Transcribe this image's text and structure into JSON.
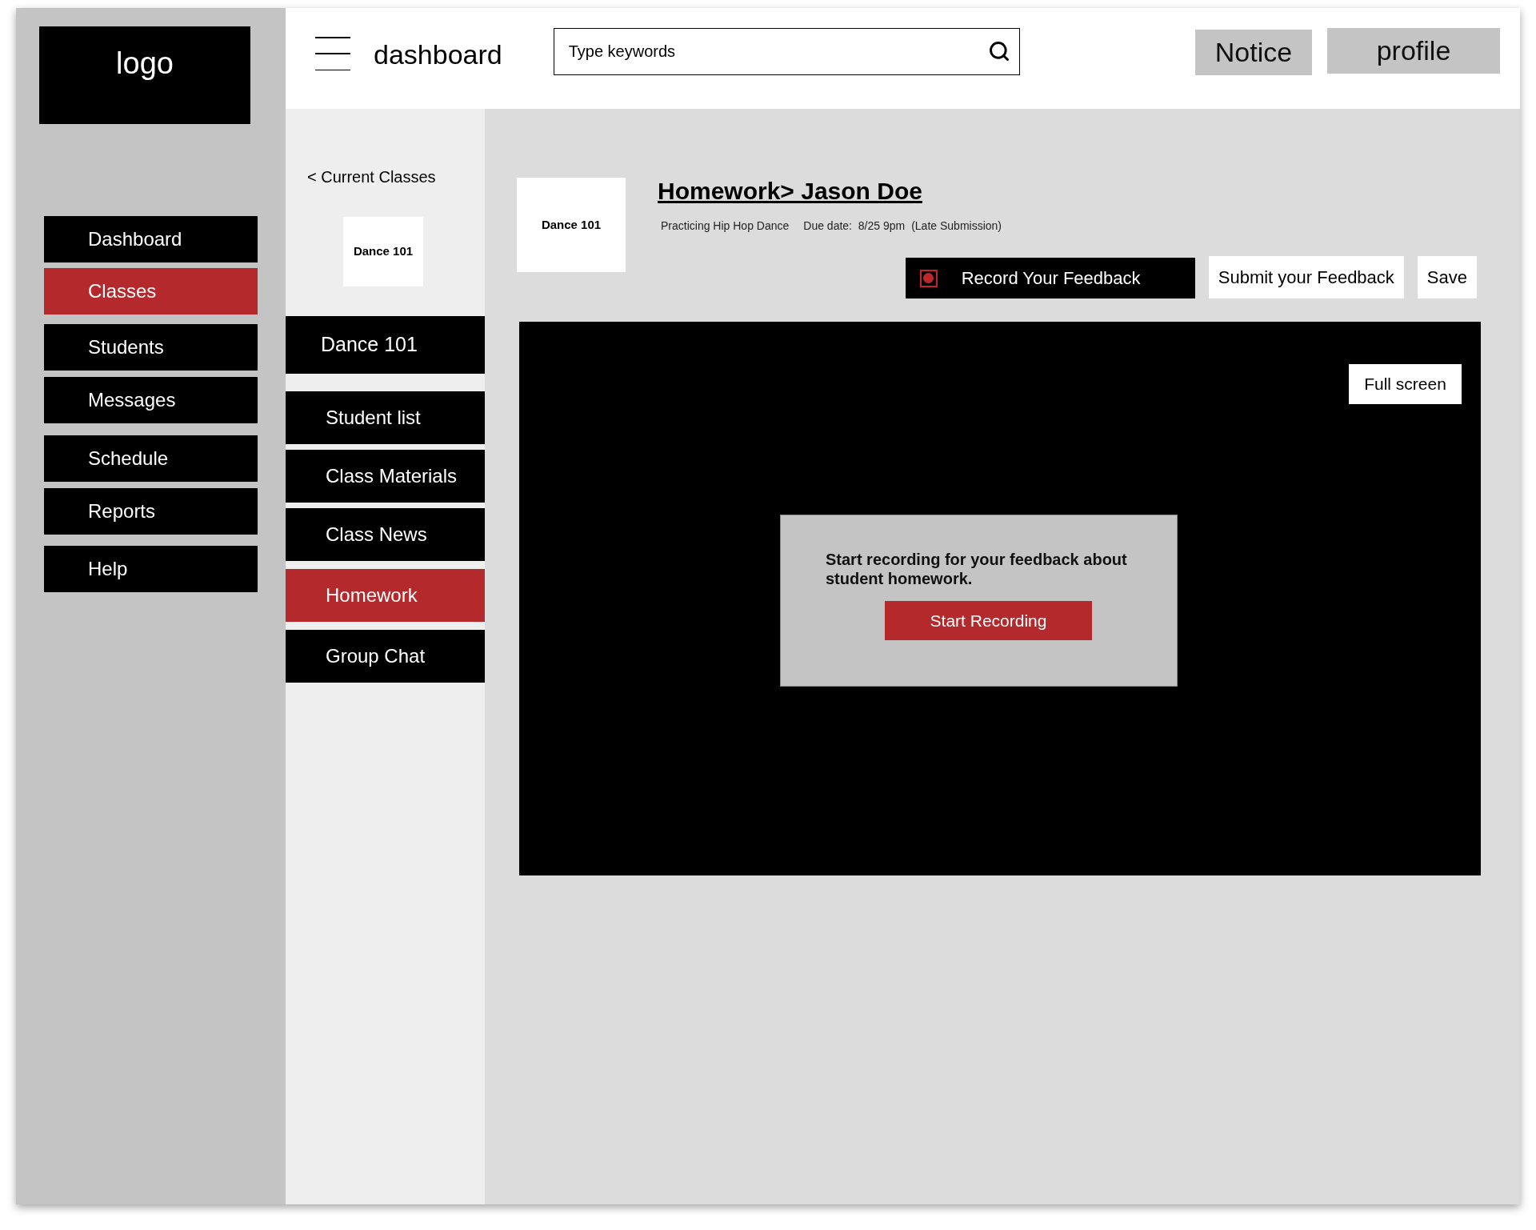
{
  "logo": "logo",
  "nav": [
    {
      "label": "Dashboard",
      "selected": false
    },
    {
      "label": "Classes",
      "selected": true
    },
    {
      "label": "Students",
      "selected": false
    },
    {
      "label": "Messages",
      "selected": false
    },
    {
      "label": "Schedule",
      "selected": false
    },
    {
      "label": "Reports",
      "selected": false
    },
    {
      "label": "Help",
      "selected": false
    }
  ],
  "header": {
    "title": "dashboard",
    "search": {
      "placeholder": "Type keywords"
    },
    "buttons": [
      "Notice",
      "profile"
    ]
  },
  "class_panel": {
    "back_link": "< Current Classes",
    "class_card": "Dance 101",
    "class_name": "Dance 101",
    "menu": [
      {
        "label": "Student list",
        "selected": false
      },
      {
        "label": "Class Materials",
        "selected": false
      },
      {
        "label": "Class News",
        "selected": false
      },
      {
        "label": "Homework",
        "selected": true
      },
      {
        "label": "Group Chat",
        "selected": false
      }
    ]
  },
  "homework": {
    "class_card": "Dance 101",
    "title": "Homework> Jason Doe",
    "assignment": "Practicing Hip Hop Dance",
    "due_date": "Due date:  8/25 9pm",
    "status": "(Late Submission)",
    "actions": [
      {
        "kind": "record",
        "label": "Record Your Feedback"
      },
      {
        "kind": "plain",
        "label": "Submit your Feedback"
      },
      {
        "kind": "plain",
        "label": "Save"
      }
    ]
  },
  "video": {
    "fullscreen_button": "Full screen",
    "prompt": {
      "message": "Start recording for your feedback about student homework.",
      "button": "Start Recording"
    }
  }
}
